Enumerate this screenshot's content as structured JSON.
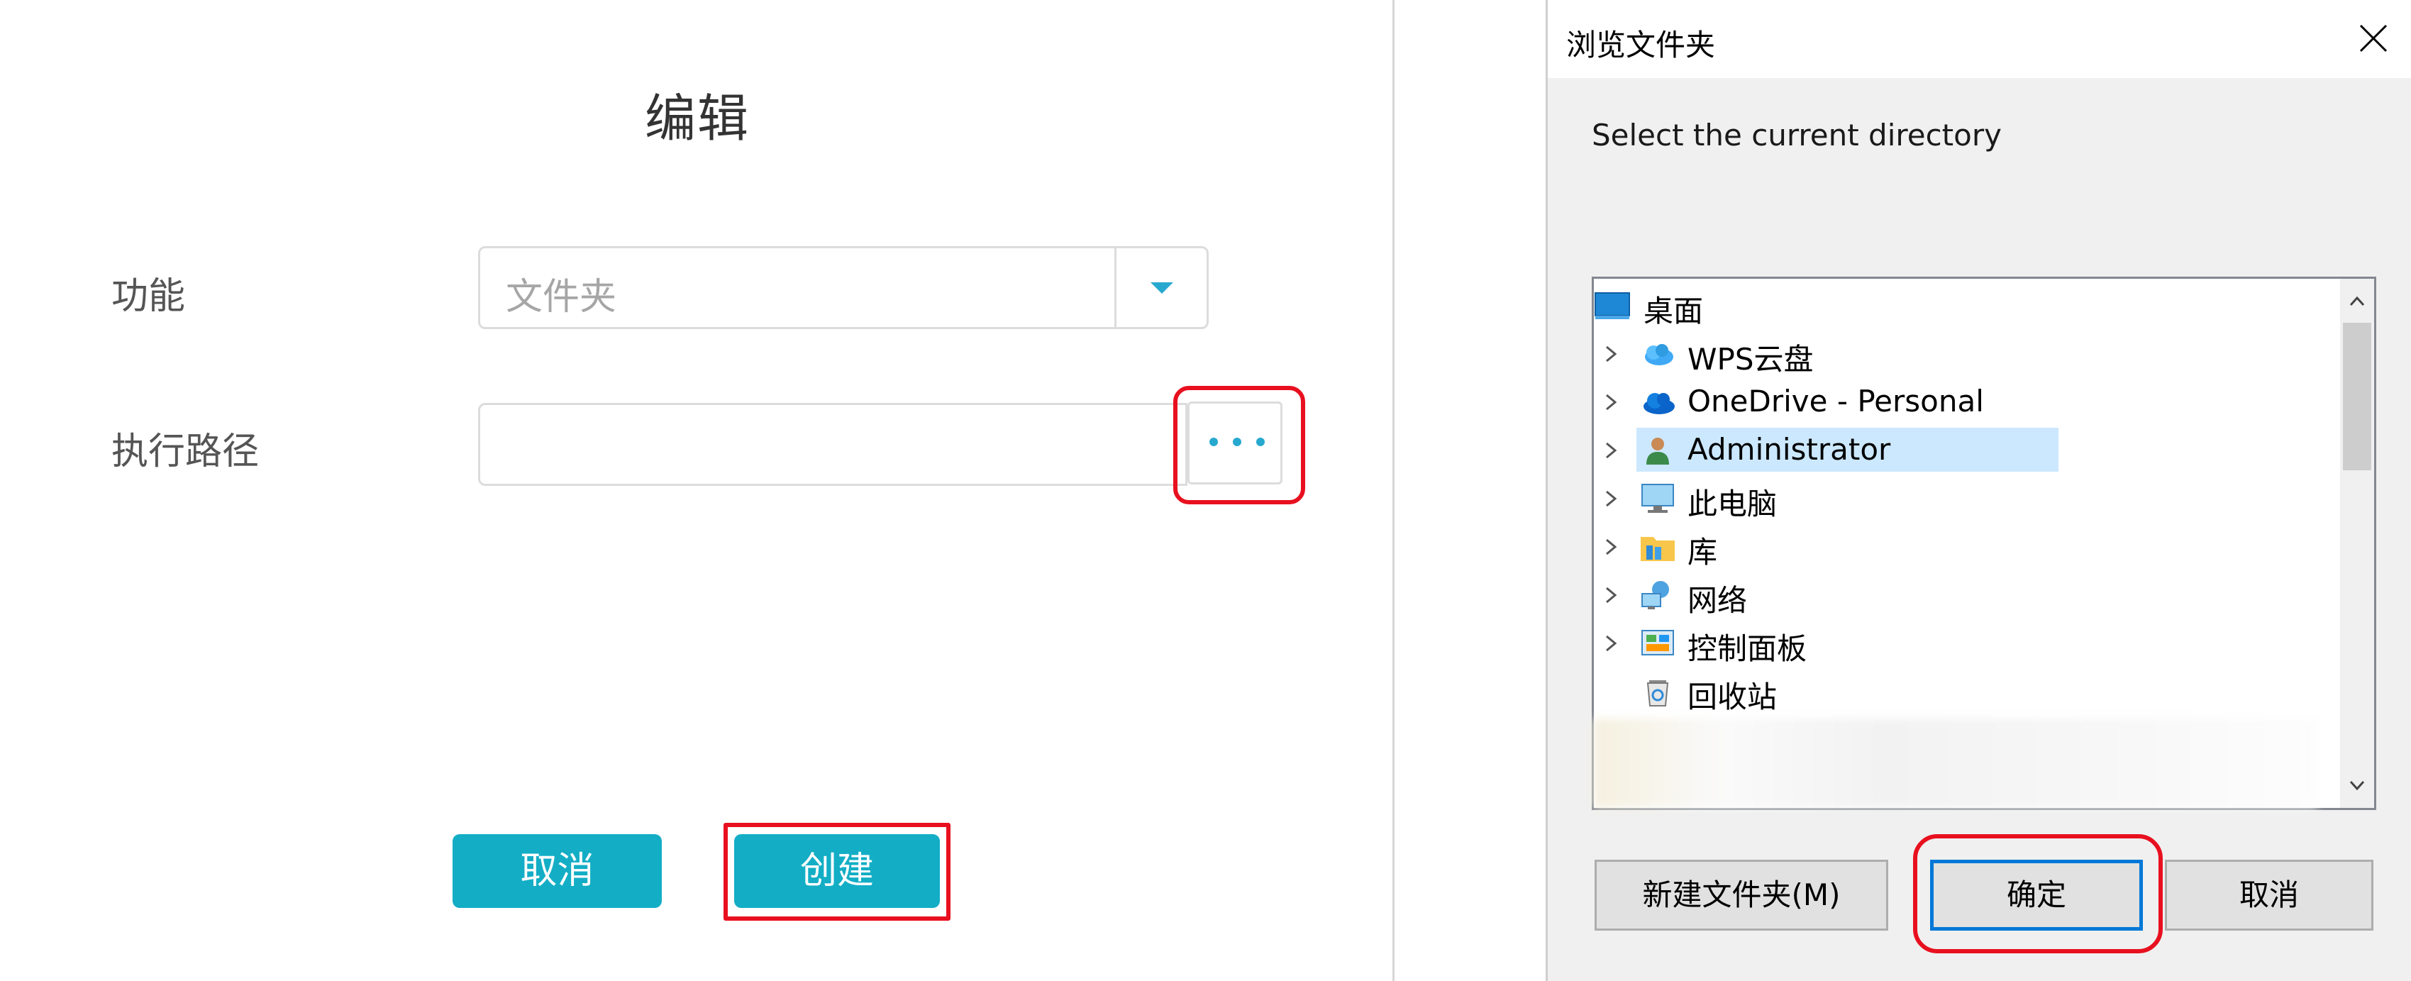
{
  "edit_dialog": {
    "title": "编辑",
    "function_label": "功能",
    "function_value": "文件夹",
    "path_label": "执行路径",
    "path_value": "",
    "browse_label": "...",
    "cancel_label": "取消",
    "create_label": "创建",
    "accent_color": "#13aec5"
  },
  "browse_dialog": {
    "title": "浏览文件夹",
    "instruction": "Select the current directory",
    "tree": [
      {
        "label": "桌面",
        "icon": "desktop-icon",
        "expandable": false,
        "root": true
      },
      {
        "label": "WPS云盘",
        "icon": "wps-cloud-icon",
        "expandable": true
      },
      {
        "label": "OneDrive - Personal",
        "icon": "onedrive-cloud-icon",
        "expandable": true
      },
      {
        "label": "Administrator",
        "icon": "user-icon",
        "expandable": true,
        "selected": true
      },
      {
        "label": "此电脑",
        "icon": "computer-icon",
        "expandable": true
      },
      {
        "label": "库",
        "icon": "library-folder-icon",
        "expandable": true
      },
      {
        "label": "网络",
        "icon": "network-icon",
        "expandable": true
      },
      {
        "label": "控制面板",
        "icon": "control-panel-icon",
        "expandable": true
      },
      {
        "label": "回收站",
        "icon": "recycle-bin-icon",
        "expandable": false
      }
    ],
    "new_folder_label": "新建文件夹(M)",
    "ok_label": "确定",
    "cancel_label": "取消"
  },
  "colors": {
    "highlight": "#e8101f",
    "selection": "#cce8ff",
    "focus_border": "#0078d7"
  }
}
